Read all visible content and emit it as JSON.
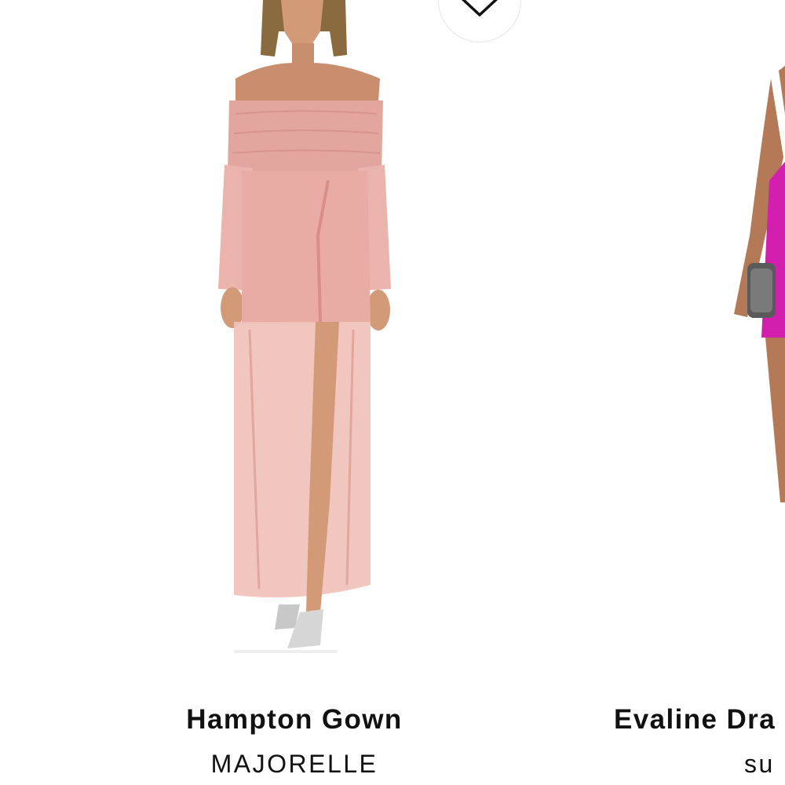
{
  "products": [
    {
      "name": "Hampton Gown",
      "brand": "MAJORELLE",
      "image": "model in blush pink off-shoulder sheer mesh gown"
    },
    {
      "name": "Evaline Dra",
      "brand": "su",
      "image": "model in magenta mini dress holding clutch"
    }
  ],
  "icons": {
    "wishlist": "heart-outline-icon"
  },
  "colors": {
    "text": "#111111",
    "background": "#ffffff",
    "dress_blush": "#e8aaa2",
    "dress_magenta": "#d21fae"
  }
}
